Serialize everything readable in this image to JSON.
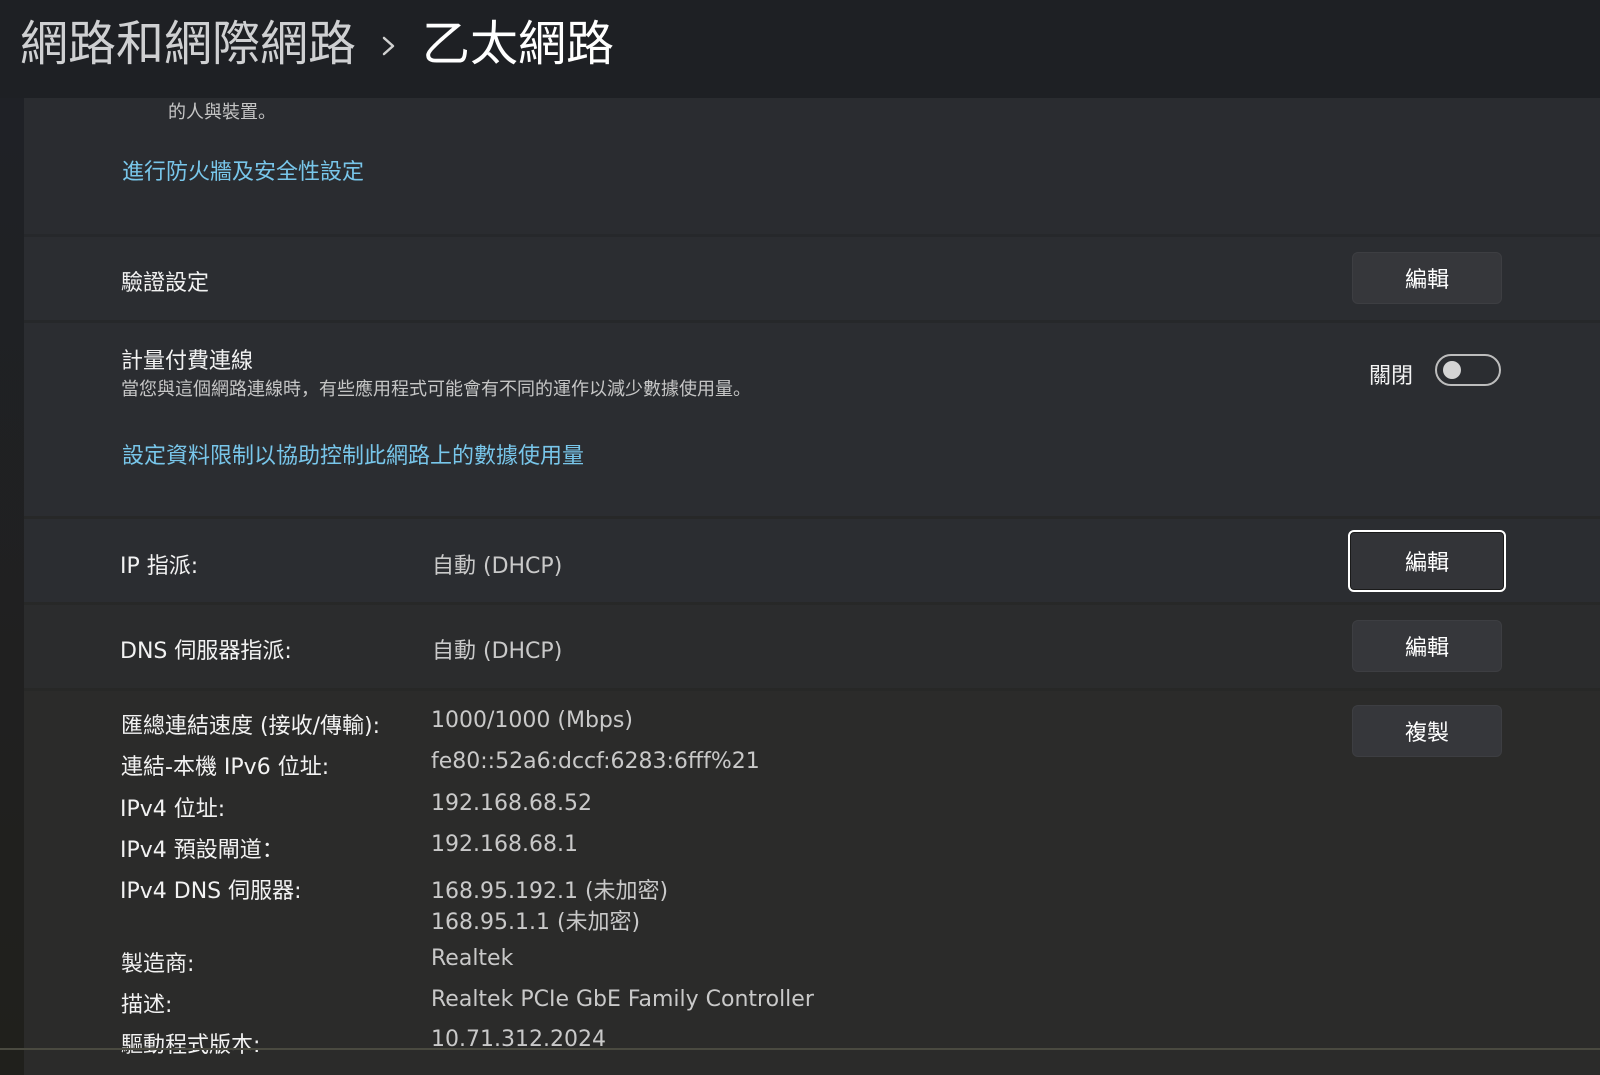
{
  "breadcrumb": {
    "parent": "網路和網際網路",
    "separator": "chevron-right-icon",
    "current": "乙太網路"
  },
  "firewall_section": {
    "description_tail": "的人與裝置。",
    "link": "進行防火牆及安全性設定"
  },
  "auth_settings": {
    "label": "驗證設定",
    "button": "編輯"
  },
  "metered": {
    "title": "計量付費連線",
    "description": "當您與這個網路連線時，有些應用程式可能會有不同的運作以減少數據使用量。",
    "state_label": "關閉",
    "link": "設定資料限制以協助控制此網路上的數據使用量"
  },
  "ip_assignment": {
    "label": "IP 指派:",
    "value": "自動 (DHCP)",
    "button": "編輯"
  },
  "dns_assignment": {
    "label": "DNS 伺服器指派:",
    "value": "自動 (DHCP)",
    "button": "編輯"
  },
  "properties": {
    "copy_button": "複製",
    "rows": [
      {
        "label": "匯總連結速度 (接收/傳輸):",
        "value": "1000/1000 (Mbps)"
      },
      {
        "label": "連結-本機 IPv6 位址:",
        "value": "fe80::52a6:dccf:6283:6fff%21"
      },
      {
        "label": "IPv4 位址:",
        "value": "192.168.68.52"
      },
      {
        "label": "IPv4 預設閘道：",
        "value": "192.168.68.1"
      },
      {
        "label": "IPv4 DNS 伺服器:",
        "value": "168.95.192.1 (未加密)",
        "value2": "168.95.1.1 (未加密)"
      },
      {
        "label": "製造商:",
        "value": "Realtek"
      },
      {
        "label": "描述:",
        "value": "Realtek PCIe GbE Family Controller"
      },
      {
        "label": "驅動程式版本:",
        "value": "10.71.312.2024"
      }
    ]
  },
  "colors": {
    "link": "#78c6ea",
    "header_bg": "#1e2024",
    "card_bg": "#2b2d31"
  }
}
